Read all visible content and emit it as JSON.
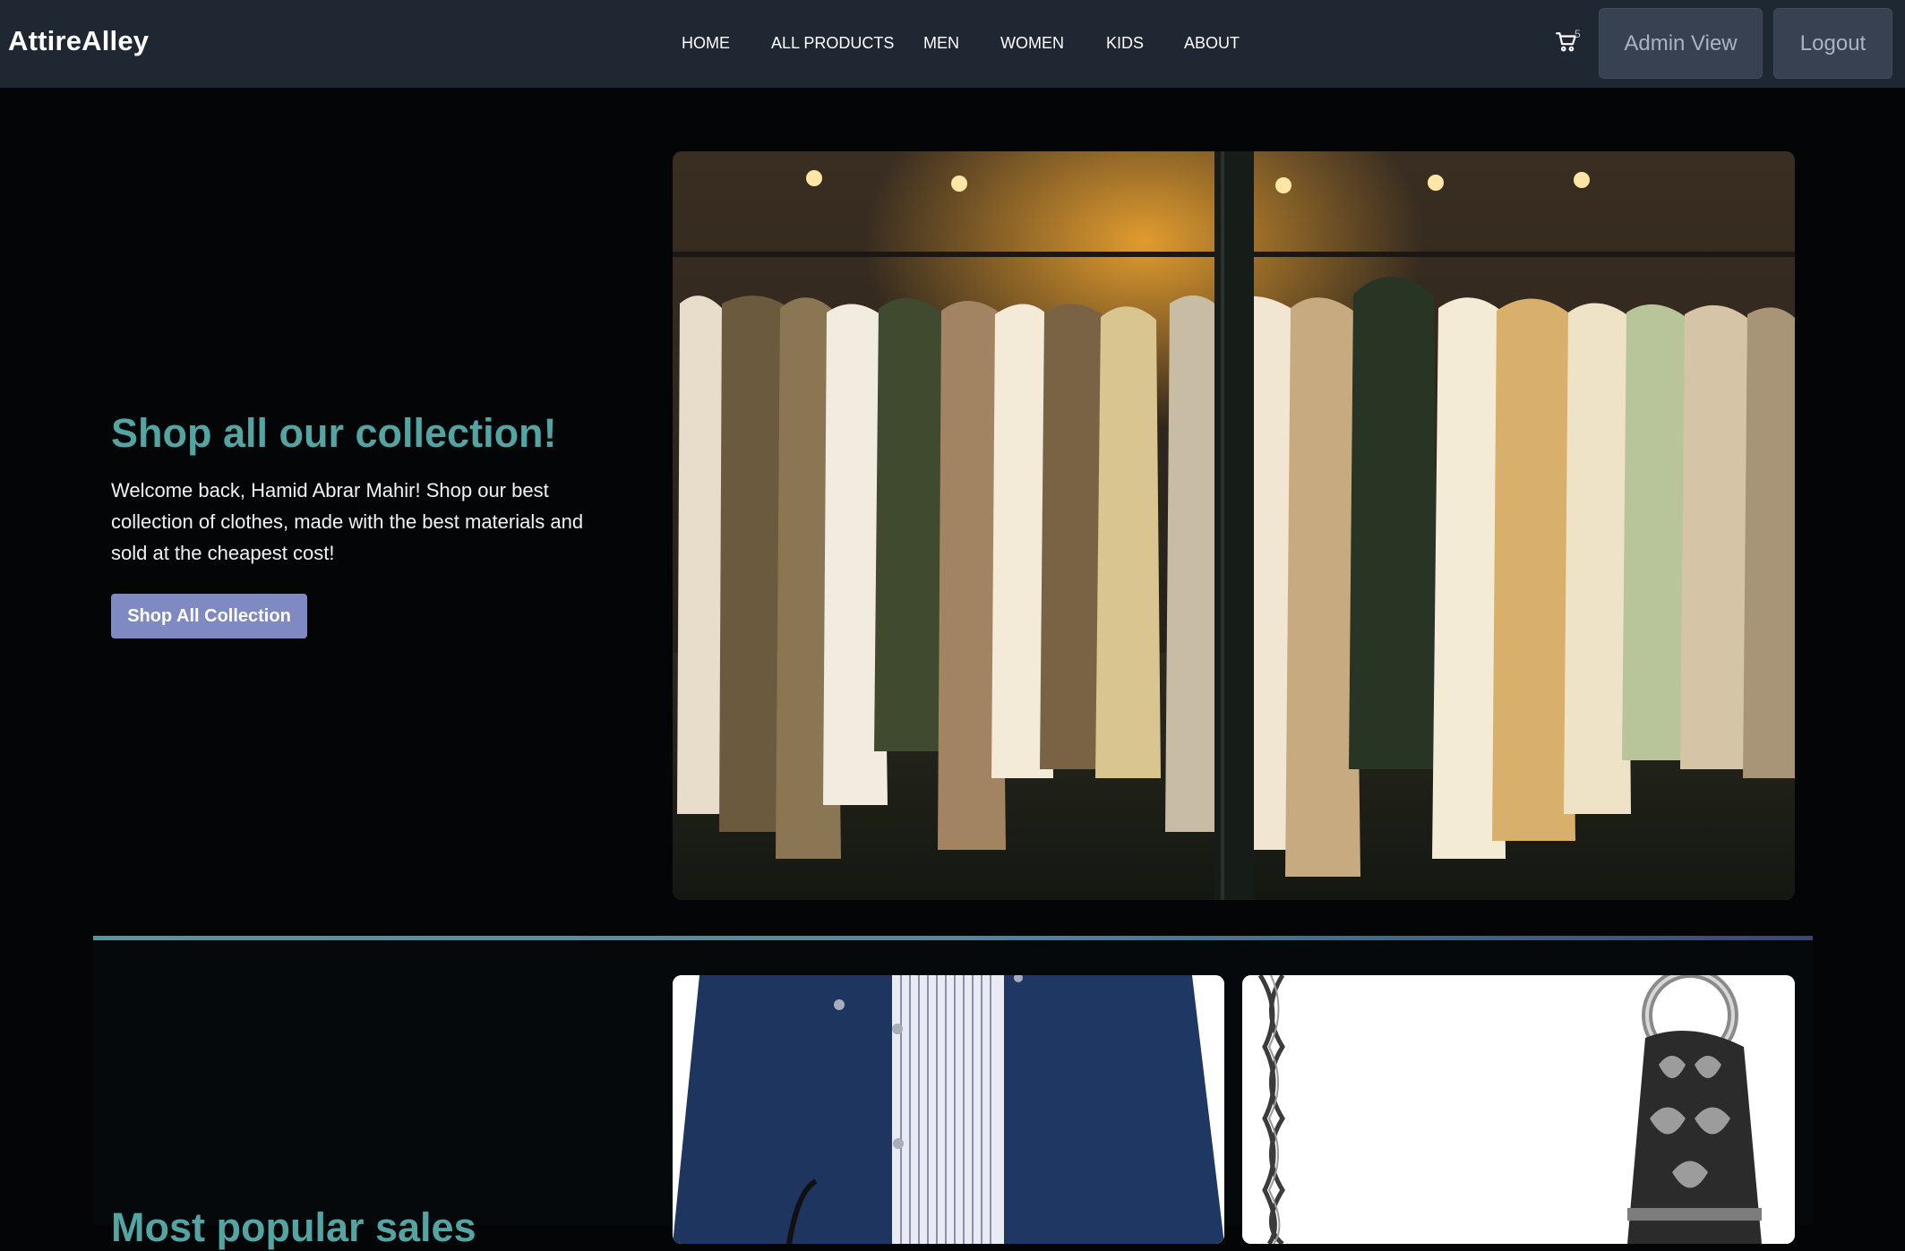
{
  "navbar": {
    "brand": "AttireAlley",
    "links": [
      {
        "label": "HOME"
      },
      {
        "label": "ALL PRODUCTS"
      },
      {
        "label": "MEN"
      },
      {
        "label": "WOMEN"
      },
      {
        "label": "KIDS"
      },
      {
        "label": "ABOUT"
      }
    ],
    "cart": {
      "icon": "cart-icon",
      "count": "5"
    },
    "admin_button": "Admin View",
    "logout_button": "Logout"
  },
  "hero": {
    "title": "Shop all our collection!",
    "text": "Welcome back, Hamid Abrar Mahir! Shop our best collection of clothes, made with the best materials and sold at the cheapest cost!",
    "button": "Shop All Collection",
    "image": "clothing-rack-photo"
  },
  "popular": {
    "title": "Most popular sales",
    "cards": [
      {
        "image": "navy-jacket-photo"
      },
      {
        "image": "silver-chain-bracelet-photo"
      }
    ]
  },
  "colors": {
    "navbar_bg": "#1f2733",
    "page_bg": "#040507",
    "accent_teal": "#53a5a3",
    "primary_button": "#7f89c2",
    "nav_button_bg": "#374151"
  }
}
